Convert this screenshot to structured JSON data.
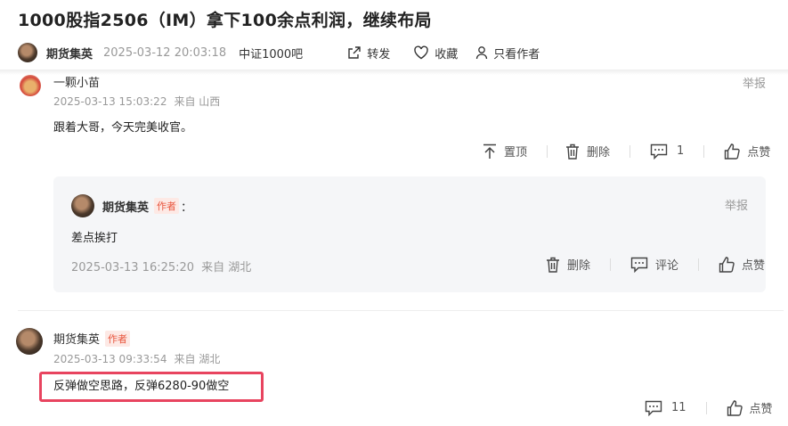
{
  "post": {
    "title": "1000股指2506（IM）拿下100余点利润，继续布局",
    "author": "期货集英",
    "time": "2025-03-12 20:03:18",
    "bar": "中证1000吧",
    "actions": {
      "forward": "转发",
      "collect": "收藏",
      "only_author": "只看作者"
    }
  },
  "comment1": {
    "user": "一颗小苗",
    "time": "2025-03-13 15:03:22",
    "location": "来自 山西",
    "text": "跟着大哥，今天完美收官。",
    "report": "举报",
    "actions": {
      "pin": "置顶",
      "delete": "删除",
      "reply_count": "1",
      "like": "点赞"
    },
    "reply": {
      "user": "期货集英",
      "badge": "作者",
      "colon": "：",
      "text": "差点挨打",
      "time": "2025-03-13 16:25:20",
      "location": "来自 湖北",
      "report": "举报",
      "actions": {
        "delete": "删除",
        "comment": "评论",
        "like": "点赞"
      }
    }
  },
  "comment2": {
    "user": "期货集英",
    "badge": "作者",
    "time": "2025-03-13 09:33:54",
    "location": "来自 湖北",
    "text": "反弹做空思路，反弹6280-90做空",
    "actions": {
      "reply_count": "11",
      "like": "点赞"
    }
  },
  "colors": {
    "highlight": "#e8445f",
    "badge": "#e8553d"
  },
  "icons": [
    "share-icon",
    "heart-icon",
    "user-icon",
    "pin-top-icon",
    "trash-icon",
    "comment-icon",
    "thumbs-up-icon"
  ]
}
